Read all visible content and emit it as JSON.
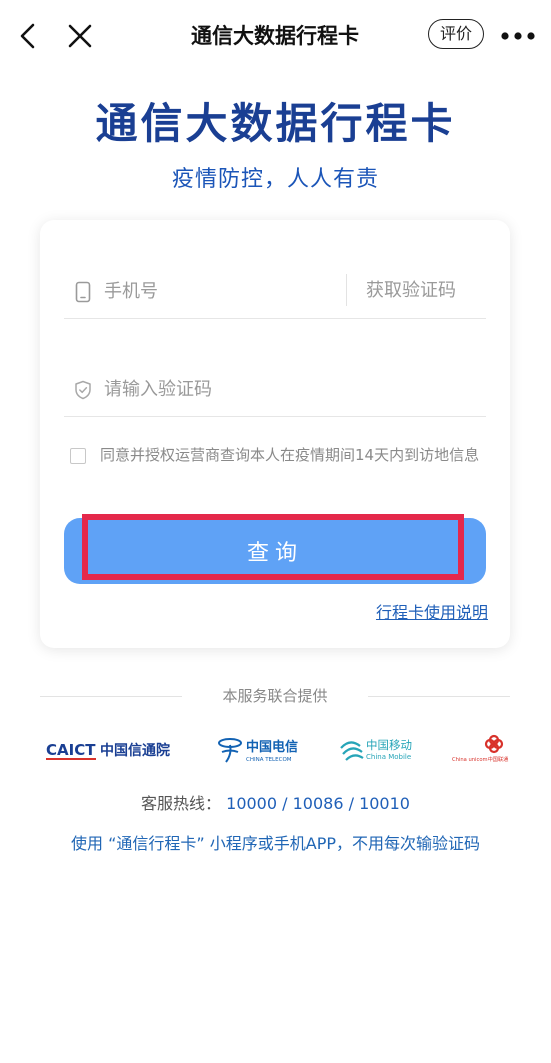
{
  "nav": {
    "title": "通信大数据行程卡",
    "rate_label": "评价"
  },
  "hero": {
    "title": "通信大数据行程卡",
    "subtitle": "疫情防控，人人有责"
  },
  "form": {
    "phone_placeholder": "手机号",
    "get_code_label": "获取验证码",
    "code_placeholder": "请输入验证码",
    "consent_text": "同意并授权运营商查询本人在疫情期间14天内到访地信息",
    "consent_checked": false,
    "query_label": "查询",
    "guide_link": "行程卡使用说明"
  },
  "providers": {
    "label": "本服务联合提供",
    "caict": {
      "mark": "CAICT",
      "name": "中国信通院"
    },
    "telecom": {
      "name": "中国电信",
      "en": "CHINA TELECOM"
    },
    "mobile": {
      "name": "中国移动",
      "en": "China Mobile"
    },
    "unicom": {
      "name": "China unicom中国联通"
    }
  },
  "hotline": {
    "label": "客服热线：",
    "numbers": "10000 / 10086 / 10010"
  },
  "tip": "使用 “通信行程卡” 小程序或手机APP，不用每次输验证码",
  "colors": {
    "brand": "#1a3f93",
    "button": "#5fa2f6",
    "highlight": "#e4284b",
    "link": "#1f5fb8"
  }
}
